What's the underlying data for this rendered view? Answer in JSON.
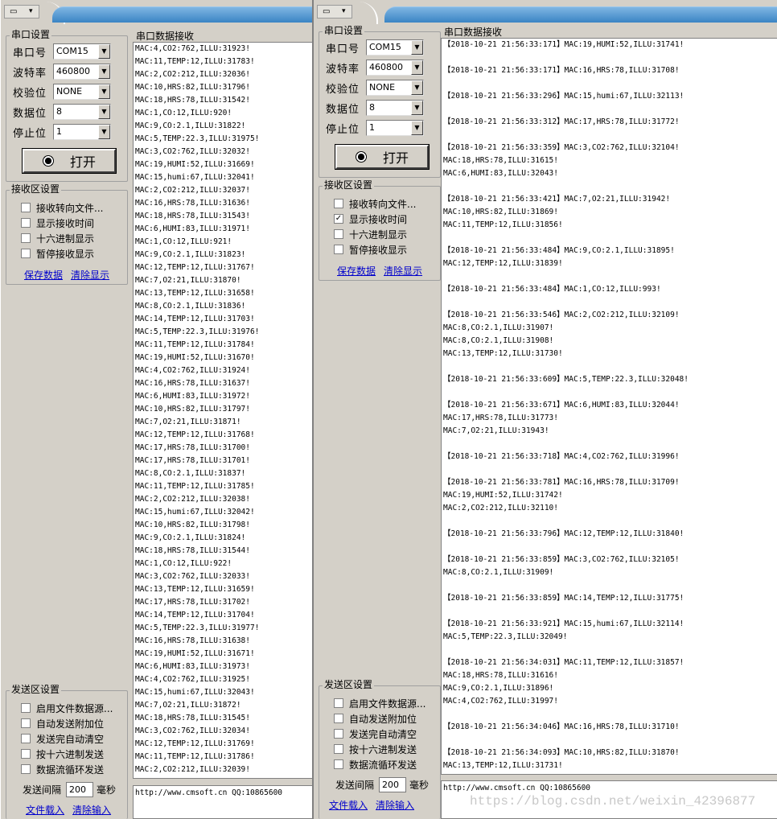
{
  "left": {
    "serial_group": "串口设置",
    "fields": [
      {
        "label": "串口号",
        "value": "COM15"
      },
      {
        "label": "波特率",
        "value": "460800"
      },
      {
        "label": "校验位",
        "value": "NONE"
      },
      {
        "label": "数据位",
        "value": "8"
      },
      {
        "label": "停止位",
        "value": "1"
      }
    ],
    "open_button": "打开",
    "recv_group": "接收区设置",
    "recv_options": [
      {
        "label": "接收转向文件...",
        "checked": false
      },
      {
        "label": "显示接收时间",
        "checked": false
      },
      {
        "label": "十六进制显示",
        "checked": false
      },
      {
        "label": "暂停接收显示",
        "checked": false
      }
    ],
    "save_data": "保存数据",
    "clear_display": "清除显示",
    "send_group": "发送区设置",
    "send_options": [
      {
        "label": "启用文件数据源...",
        "checked": false
      },
      {
        "label": "自动发送附加位",
        "checked": false
      },
      {
        "label": "发送完自动清空",
        "checked": false
      },
      {
        "label": "按十六进制发送",
        "checked": false
      },
      {
        "label": "数据流循环发送",
        "checked": false
      }
    ],
    "interval_label": "发送间隔",
    "interval_value": "200",
    "interval_unit": "毫秒",
    "load_file": "文件载入",
    "clear_input": "清除输入",
    "recv_title": "串口数据接收",
    "recv_lines": [
      "MAC:4,CO2:762,ILLU:31923!",
      "MAC:11,TEMP:12,ILLU:31783!",
      "MAC:2,CO2:212,ILLU:32036!",
      "MAC:10,HRS:82,ILLU:31796!",
      "MAC:18,HRS:78,ILLU:31542!",
      "MAC:1,CO:12,ILLU:920!",
      "MAC:9,CO:2.1,ILLU:31822!",
      "MAC:5,TEMP:22.3,ILLU:31975!",
      "MAC:3,CO2:762,ILLU:32032!",
      "MAC:19,HUMI:52,ILLU:31669!",
      "MAC:15,humi:67,ILLU:32041!",
      "MAC:2,CO2:212,ILLU:32037!",
      "MAC:16,HRS:78,ILLU:31636!",
      "MAC:18,HRS:78,ILLU:31543!",
      "MAC:6,HUMI:83,ILLU:31971!",
      "MAC:1,CO:12,ILLU:921!",
      "MAC:9,CO:2.1,ILLU:31823!",
      "MAC:12,TEMP:12,ILLU:31767!",
      "MAC:7,O2:21,ILLU:31870!",
      "MAC:13,TEMP:12,ILLU:31658!",
      "MAC:8,CO:2.1,ILLU:31836!",
      "MAC:14,TEMP:12,ILLU:31703!",
      "MAC:5,TEMP:22.3,ILLU:31976!",
      "MAC:11,TEMP:12,ILLU:31784!",
      "MAC:19,HUMI:52,ILLU:31670!",
      "MAC:4,CO2:762,ILLU:31924!",
      "MAC:16,HRS:78,ILLU:31637!",
      "MAC:6,HUMI:83,ILLU:31972!",
      "MAC:10,HRS:82,ILLU:31797!",
      "MAC:7,O2:21,ILLU:31871!",
      "MAC:12,TEMP:12,ILLU:31768!",
      "MAC:17,HRS:78,ILLU:31700!",
      "MAC:17,HRS:78,ILLU:31701!",
      "MAC:8,CO:2.1,ILLU:31837!",
      "MAC:11,TEMP:12,ILLU:31785!",
      "MAC:2,CO2:212,ILLU:32038!",
      "MAC:15,humi:67,ILLU:32042!",
      "MAC:10,HRS:82,ILLU:31798!",
      "MAC:9,CO:2.1,ILLU:31824!",
      "MAC:18,HRS:78,ILLU:31544!",
      "MAC:1,CO:12,ILLU:922!",
      "MAC:3,CO2:762,ILLU:32033!",
      "MAC:13,TEMP:12,ILLU:31659!",
      "MAC:17,HRS:78,ILLU:31702!",
      "MAC:14,TEMP:12,ILLU:31704!",
      "MAC:5,TEMP:22.3,ILLU:31977!",
      "MAC:16,HRS:78,ILLU:31638!",
      "MAC:19,HUMI:52,ILLU:31671!",
      "MAC:6,HUMI:83,ILLU:31973!",
      "MAC:4,CO2:762,ILLU:31925!",
      "MAC:15,humi:67,ILLU:32043!",
      "MAC:7,O2:21,ILLU:31872!",
      "MAC:18,HRS:78,ILLU:31545!",
      "MAC:3,CO2:762,ILLU:32034!",
      "MAC:12,TEMP:12,ILLU:31769!",
      "MAC:11,TEMP:12,ILLU:31786!",
      "MAC:2,CO2:212,ILLU:32039!"
    ],
    "send_text": "http://www.cmsoft.cn QQ:10865600"
  },
  "right": {
    "serial_group": "串口设置",
    "fields": [
      {
        "label": "串口号",
        "value": "COM15"
      },
      {
        "label": "波特率",
        "value": "460800"
      },
      {
        "label": "校验位",
        "value": "NONE"
      },
      {
        "label": "数据位",
        "value": "8"
      },
      {
        "label": "停止位",
        "value": "1"
      }
    ],
    "open_button": "打开",
    "recv_group": "接收区设置",
    "recv_options": [
      {
        "label": "接收转向文件...",
        "checked": false
      },
      {
        "label": "显示接收时间",
        "checked": true
      },
      {
        "label": "十六进制显示",
        "checked": false
      },
      {
        "label": "暂停接收显示",
        "checked": false
      }
    ],
    "save_data": "保存数据",
    "clear_display": "清除显示",
    "send_group": "发送区设置",
    "send_options": [
      {
        "label": "启用文件数据源...",
        "checked": false
      },
      {
        "label": "自动发送附加位",
        "checked": false
      },
      {
        "label": "发送完自动清空",
        "checked": false
      },
      {
        "label": "按十六进制发送",
        "checked": false
      },
      {
        "label": "数据流循环发送",
        "checked": false
      }
    ],
    "interval_label": "发送间隔",
    "interval_value": "200",
    "interval_unit": "毫秒",
    "load_file": "文件载入",
    "clear_input": "清除输入",
    "recv_title": "串口数据接收",
    "recv_lines": [
      "【2018-10-21 21:56:33:171】MAC:19,HUMI:52,ILLU:31741!",
      "",
      "【2018-10-21 21:56:33:171】MAC:16,HRS:78,ILLU:31708!",
      "",
      "【2018-10-21 21:56:33:296】MAC:15,humi:67,ILLU:32113!",
      "",
      "【2018-10-21 21:56:33:312】MAC:17,HRS:78,ILLU:31772!",
      "",
      "【2018-10-21 21:56:33:359】MAC:3,CO2:762,ILLU:32104!",
      "MAC:18,HRS:78,ILLU:31615!",
      "MAC:6,HUMI:83,ILLU:32043!",
      "",
      "【2018-10-21 21:56:33:421】MAC:7,O2:21,ILLU:31942!",
      "MAC:10,HRS:82,ILLU:31869!",
      "MAC:11,TEMP:12,ILLU:31856!",
      "",
      "【2018-10-21 21:56:33:484】MAC:9,CO:2.1,ILLU:31895!",
      "MAC:12,TEMP:12,ILLU:31839!",
      "",
      "【2018-10-21 21:56:33:484】MAC:1,CO:12,ILLU:993!",
      "",
      "【2018-10-21 21:56:33:546】MAC:2,CO2:212,ILLU:32109!",
      "MAC:8,CO:2.1,ILLU:31907!",
      "MAC:8,CO:2.1,ILLU:31908!",
      "MAC:13,TEMP:12,ILLU:31730!",
      "",
      "【2018-10-21 21:56:33:609】MAC:5,TEMP:22.3,ILLU:32048!",
      "",
      "【2018-10-21 21:56:33:671】MAC:6,HUMI:83,ILLU:32044!",
      "MAC:17,HRS:78,ILLU:31773!",
      "MAC:7,O2:21,ILLU:31943!",
      "",
      "【2018-10-21 21:56:33:718】MAC:4,CO2:762,ILLU:31996!",
      "",
      "【2018-10-21 21:56:33:781】MAC:16,HRS:78,ILLU:31709!",
      "MAC:19,HUMI:52,ILLU:31742!",
      "MAC:2,CO2:212,ILLU:32110!",
      "",
      "【2018-10-21 21:56:33:796】MAC:12,TEMP:12,ILLU:31840!",
      "",
      "【2018-10-21 21:56:33:859】MAC:3,CO2:762,ILLU:32105!",
      "MAC:8,CO:2.1,ILLU:31909!",
      "",
      "【2018-10-21 21:56:33:859】MAC:14,TEMP:12,ILLU:31775!",
      "",
      "【2018-10-21 21:56:33:921】MAC:15,humi:67,ILLU:32114!",
      "MAC:5,TEMP:22.3,ILLU:32049!",
      "",
      "【2018-10-21 21:56:34:031】MAC:11,TEMP:12,ILLU:31857!",
      "MAC:18,HRS:78,ILLU:31616!",
      "MAC:9,CO:2.1,ILLU:31896!",
      "MAC:4,CO2:762,ILLU:31997!",
      "",
      "【2018-10-21 21:56:34:046】MAC:16,HRS:78,ILLU:31710!",
      "",
      "【2018-10-21 21:56:34:093】MAC:10,HRS:82,ILLU:31870!",
      "MAC:13,TEMP:12,ILLU:31731!"
    ],
    "send_text": "http://www.cmsoft.cn QQ:10865600"
  },
  "watermark": "https://blog.csdn.net/weixin_42396877"
}
